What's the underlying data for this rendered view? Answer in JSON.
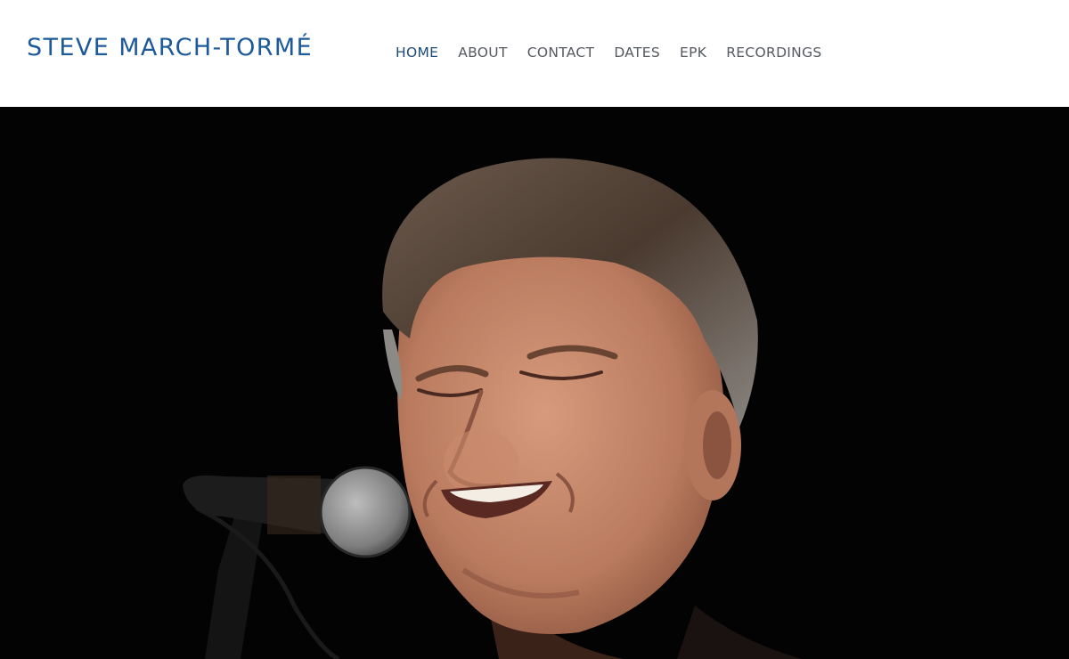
{
  "site": {
    "title": "STEVE MARCH-TORMÉ",
    "brand_color": "#1d5a9a"
  },
  "nav": {
    "items": [
      {
        "label": "HOME",
        "active": true
      },
      {
        "label": "ABOUT",
        "active": false
      },
      {
        "label": "CONTACT",
        "active": false
      },
      {
        "label": "DATES",
        "active": false
      },
      {
        "label": "EPK",
        "active": false
      },
      {
        "label": "RECORDINGS",
        "active": false
      }
    ]
  },
  "hero": {
    "background_color": "#030303"
  }
}
